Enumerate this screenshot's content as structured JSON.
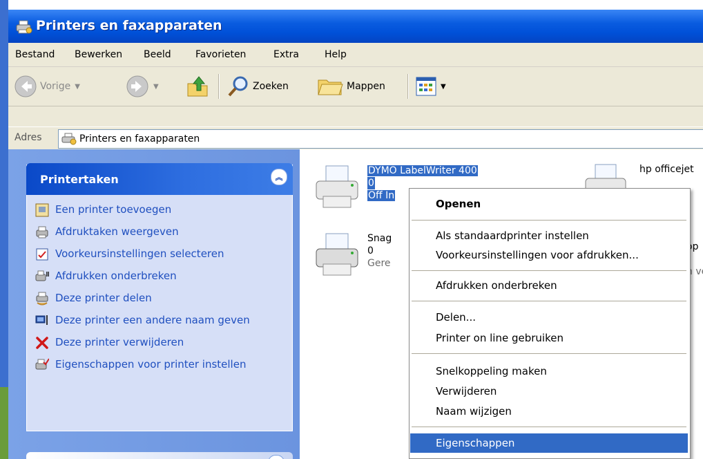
{
  "window": {
    "title": "Printers en faxapparaten",
    "colors": {
      "titlebar": "#0a5ce0",
      "taskpane": "#6b94df",
      "selection": "#316ac5"
    }
  },
  "menu": [
    "Bestand",
    "Bewerken",
    "Beeld",
    "Favorieten",
    "Extra",
    "Help"
  ],
  "toolbar": {
    "back_label": "Vorige",
    "search_label": "Zoeken",
    "folders_label": "Mappen"
  },
  "address": {
    "label": "Adres",
    "value": "Printers en faxapparaten"
  },
  "task_pane": {
    "header": "Printertaken",
    "tasks": [
      {
        "label": "Een printer toevoegen",
        "icon": "add-printer-icon"
      },
      {
        "label": "Afdruktaken weergeven",
        "icon": "print-jobs-icon"
      },
      {
        "label": "Voorkeursinstellingen selecteren",
        "icon": "preferences-icon"
      },
      {
        "label": "Afdrukken onderbreken",
        "icon": "pause-printing-icon"
      },
      {
        "label": "Deze printer delen",
        "icon": "share-printer-icon"
      },
      {
        "label": "Deze printer een andere naam geven",
        "icon": "rename-printer-icon"
      },
      {
        "label": "Deze printer verwijderen",
        "icon": "delete-icon"
      },
      {
        "label": "Eigenschappen voor printer instellen",
        "icon": "properties-icon"
      }
    ]
  },
  "printers": [
    {
      "name": "DYMO LabelWriter 400",
      "count": "0",
      "status": "Off In"
    },
    {
      "name": "hp officejet",
      "count": "",
      "status": ""
    },
    {
      "name": "Snag",
      "count": "0",
      "status": "Gere"
    },
    {
      "name": "op",
      "count": "",
      "status": "n ve"
    }
  ],
  "context_menu": {
    "items": [
      {
        "label": "Openen",
        "bold": true
      },
      {
        "label": "Als standaardprinter instellen"
      },
      {
        "label": "Voorkeursinstellingen voor afdrukken..."
      },
      {
        "label": "Afdrukken onderbreken"
      },
      {
        "label": "Delen..."
      },
      {
        "label": "Printer on line gebruiken"
      },
      {
        "label": "Snelkoppeling maken"
      },
      {
        "label": "Verwijderen"
      },
      {
        "label": "Naam wijzigen"
      },
      {
        "label": "Eigenschappen",
        "highlighted": true
      }
    ]
  }
}
